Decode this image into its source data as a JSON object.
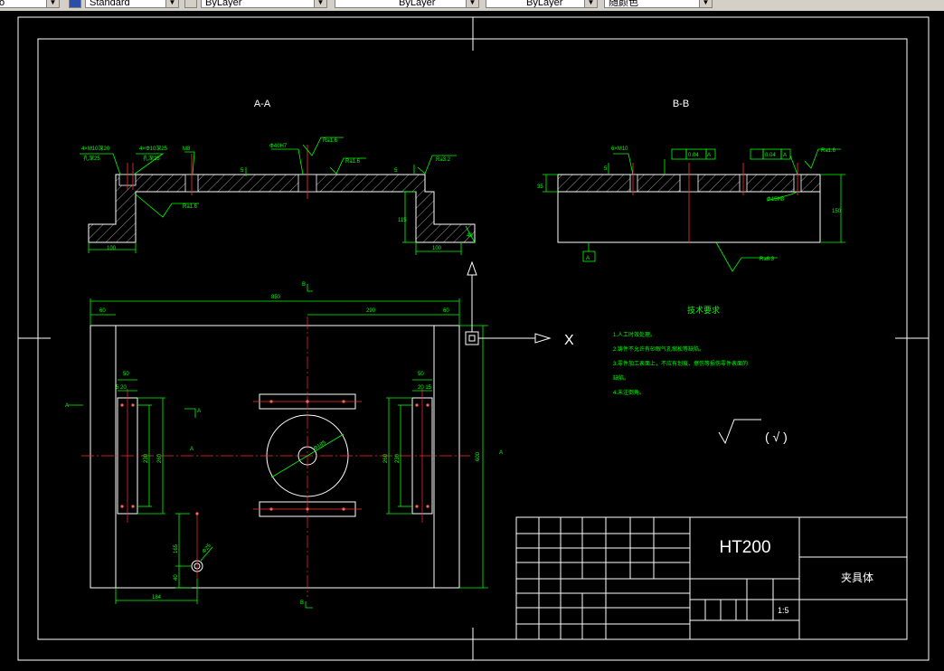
{
  "toolbar": {
    "textstyle_tail": "o",
    "dimstyle": "Standard",
    "layer": "ByLayer",
    "linetype": "ByLayer",
    "lineweight": "ByLayer",
    "plotstyle": "随颜色"
  },
  "drawing": {
    "section_aa": "A-A",
    "section_bb": "B-B",
    "tech_title": "技术要求",
    "tech_items": [
      "1.人工时效处理。",
      "2.铸件不允许有砂眼气孔缩松等缺陷。",
      "3.零件加工表面上，不应有划痕、擦伤等损伤零件表面的",
      "缺陷。",
      "4.未注倒角。"
    ],
    "material": "HT200",
    "part_name": "夹具体",
    "scale": "1:5",
    "ucs_x": "X",
    "dims_plan": {
      "overall": "850",
      "left_margin": "60",
      "right_margin": "60",
      "right_span": "290",
      "height": "600",
      "slot_w_left": "50",
      "slot_w_right": "50",
      "slot_sub_left": "5 20",
      "slot_sub_right": "20 15",
      "slot_in_left": "230",
      "slot_out_left": "260",
      "slot_in_right": "230",
      "slot_out_right": "260",
      "bottom_x": "184",
      "hole_y": "165",
      "hole_off": "40",
      "hole_dia": "Φ25",
      "center_dia": "Φ185"
    },
    "dims_aa": {
      "hole_left": "4×M10深20",
      "hole_left_sub": "孔深25",
      "hole_mid": "4×Φ10深25",
      "hole_mid_sub": "孔深25",
      "m8": "M8",
      "center": "Φ40H7",
      "r1": "Ra1.6",
      "r2": "Ra1.6",
      "r3": "Ra3.2",
      "r4": "Ra1.6",
      "five_a": "5",
      "five_b": "5",
      "depth": "115",
      "w_left": "100",
      "w_right": "100",
      "thick": "40"
    },
    "dims_bb": {
      "m10": "6×M10",
      "tol1": "0.04",
      "tol2": "0.04",
      "datum": "A",
      "r_top": "Ra1.6",
      "r_bot": "Ra6.3",
      "five": "5",
      "h35": "35",
      "h150": "150",
      "dia": "Φ15H8"
    },
    "section_marks": {
      "a": "A",
      "b": "B"
    },
    "roughness_note": "( √ )"
  }
}
